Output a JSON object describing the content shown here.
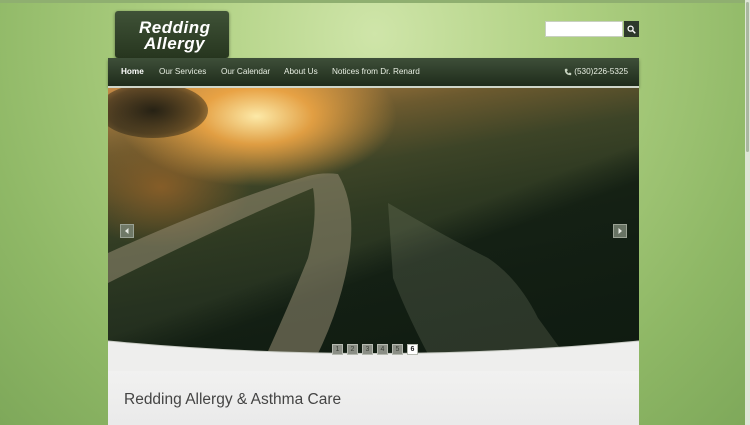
{
  "logo": {
    "line1": "Redding",
    "line2": "Allergy"
  },
  "search": {
    "placeholder": "",
    "value": "",
    "button_icon": "search-icon"
  },
  "nav": {
    "items": [
      {
        "label": "Home",
        "active": true
      },
      {
        "label": "Our Services"
      },
      {
        "label": "Our Calendar"
      },
      {
        "label": "About Us"
      },
      {
        "label": "Notices from Dr. Renard"
      }
    ],
    "phone": "(530)226-5325",
    "phone_icon": "phone-icon"
  },
  "slider": {
    "pages": [
      "1",
      "2",
      "3",
      "4",
      "5",
      "6"
    ],
    "active_page": "6",
    "prev_icon": "chevron-left-icon",
    "next_icon": "chevron-right-icon"
  },
  "content": {
    "title": "Redding Allergy & Asthma Care"
  },
  "colors": {
    "nav_bg": "#2f3e2b",
    "page_bg": "#a9cd7e",
    "accent": "#ffffff"
  }
}
